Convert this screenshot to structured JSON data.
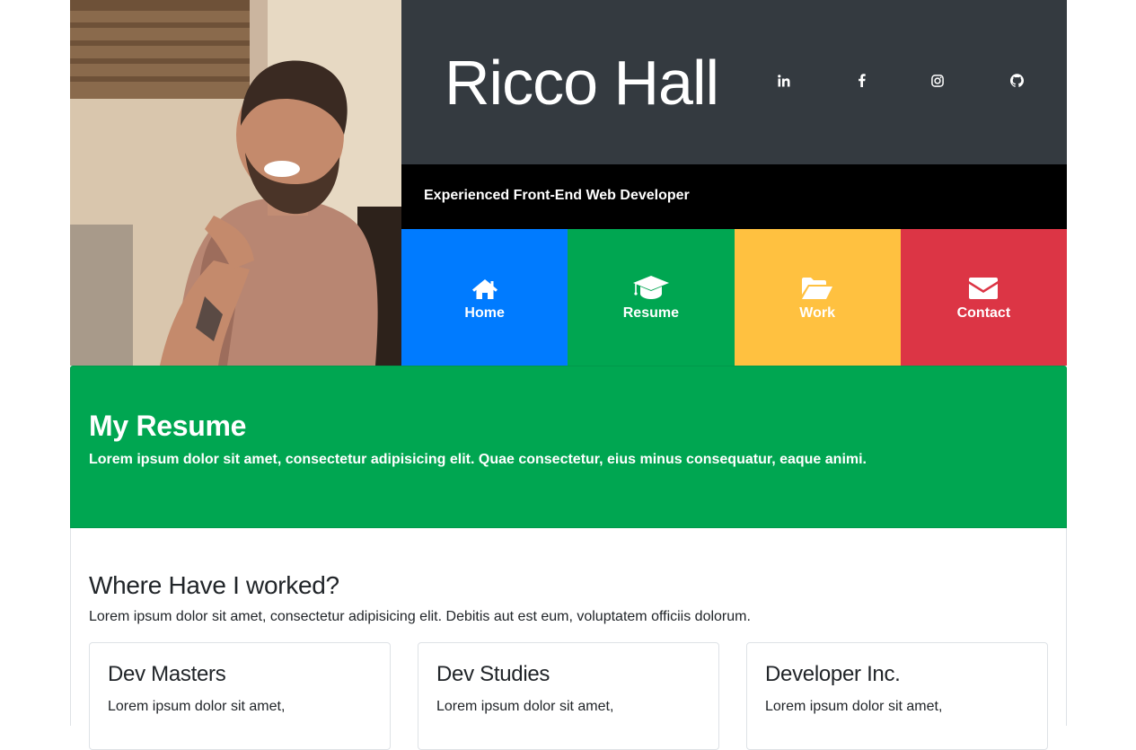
{
  "header": {
    "name": "Ricco Hall",
    "tagline": "Experienced Front-End Web Developer",
    "colors": {
      "name_bar": "#343a40",
      "tagline_bar": "#000000"
    }
  },
  "social": [
    {
      "icon": "linkedin-icon"
    },
    {
      "icon": "facebook-icon"
    },
    {
      "icon": "instagram-icon"
    },
    {
      "icon": "github-icon"
    }
  ],
  "nav": [
    {
      "label": "Home",
      "icon": "home-icon",
      "color": "#007bff"
    },
    {
      "label": "Resume",
      "icon": "graduation-cap-icon",
      "color": "#00a651"
    },
    {
      "label": "Work",
      "icon": "folder-open-icon",
      "color": "#ffc140"
    },
    {
      "label": "Contact",
      "icon": "envelope-icon",
      "color": "#dc3545"
    }
  ],
  "resume": {
    "title": "My Resume",
    "text": "Lorem ipsum dolor sit amet, consectetur adipisicing elit. Quae consectetur, eius minus consequatur, eaque animi."
  },
  "work": {
    "title": "Where Have I worked?",
    "text": "Lorem ipsum dolor sit amet, consectetur adipisicing elit. Debitis aut est eum, voluptatem officiis dolorum.",
    "cards": [
      {
        "title": "Dev Masters",
        "text": "Lorem ipsum dolor sit amet,"
      },
      {
        "title": "Dev Studies",
        "text": "Lorem ipsum dolor sit amet,"
      },
      {
        "title": "Developer Inc.",
        "text": "Lorem ipsum dolor sit amet,"
      }
    ]
  }
}
